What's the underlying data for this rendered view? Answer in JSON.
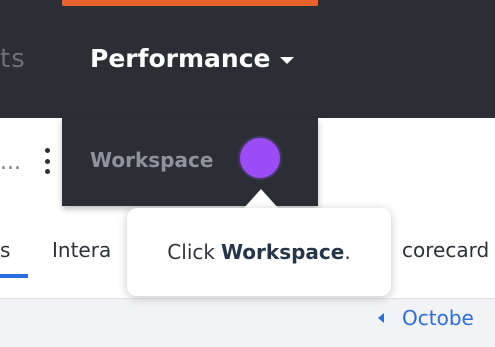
{
  "header": {
    "nav_partial_label": "ts",
    "nav_performance_label": "Performance"
  },
  "toolbar": {
    "ellipsis_partial": "..."
  },
  "dropdown": {
    "items": [
      {
        "label": "Workspace"
      }
    ]
  },
  "tabs": {
    "partial_left": "s",
    "interactions_partial": "Intera",
    "scorecard_partial": "corecard"
  },
  "date_nav": {
    "label_partial": "Octobe"
  },
  "tooltip": {
    "prefix": "Click",
    "target": "Workspace",
    "suffix": "."
  },
  "colors": {
    "topbar_bg": "#2b2f35",
    "accent": "#e8622c",
    "hotspot": "#9b4cf5",
    "link_blue": "#2c6ee0"
  },
  "icons": {
    "performance_dropdown": "caret-down-icon",
    "more_menu": "kebab-menu-icon",
    "date_prev": "chevron-left-icon"
  }
}
